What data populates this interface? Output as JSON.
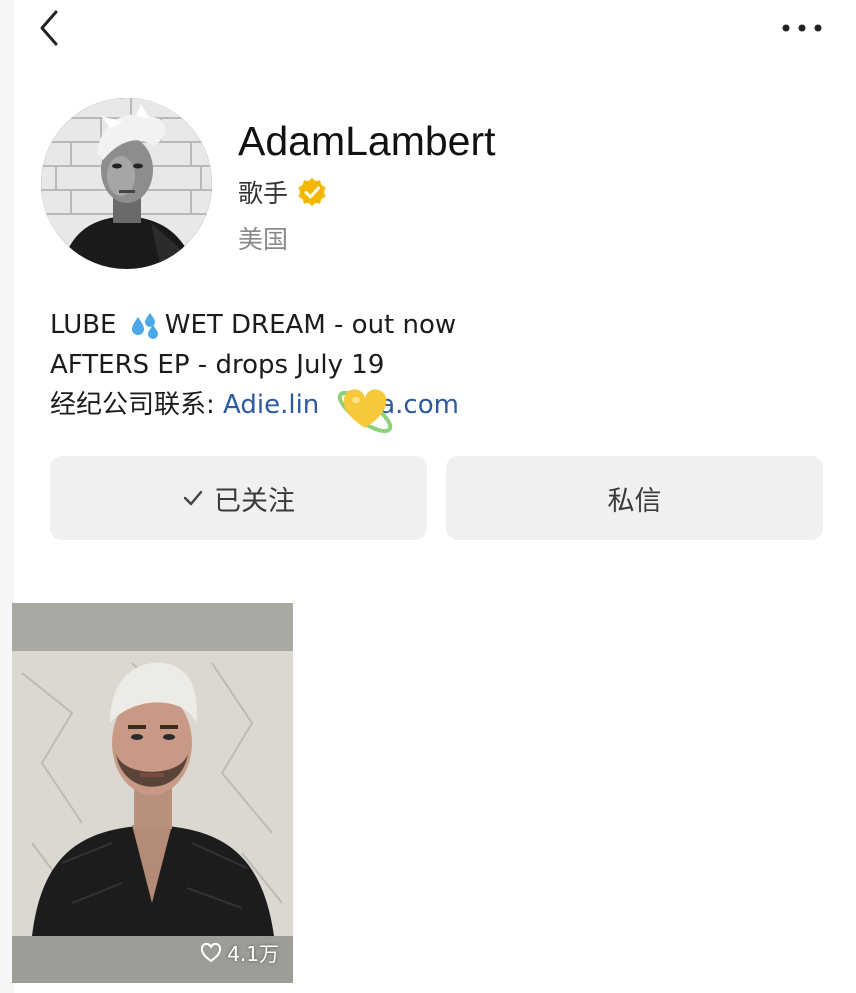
{
  "nav": {
    "back_icon": "chevron-left-icon",
    "more_icon": "more-dots-icon"
  },
  "profile": {
    "name": "AdamLambert",
    "role": "歌手",
    "verified_icon": "verified-badge-icon",
    "verified_color": "#f5b800",
    "location": "美国"
  },
  "bio": {
    "line1_before": "LUBE ",
    "line1_after": "WET DREAM - out now",
    "line2": "AFTERS EP - drops July 19",
    "line3_label": "经纪公司联系: ",
    "line3_email_start": "Adie.lin",
    "line3_email_end": "aa.com",
    "link_color": "#2d5a9e"
  },
  "actions": {
    "follow_label": "已关注",
    "message_label": "私信"
  },
  "posts": [
    {
      "likes": "4.1万"
    }
  ]
}
